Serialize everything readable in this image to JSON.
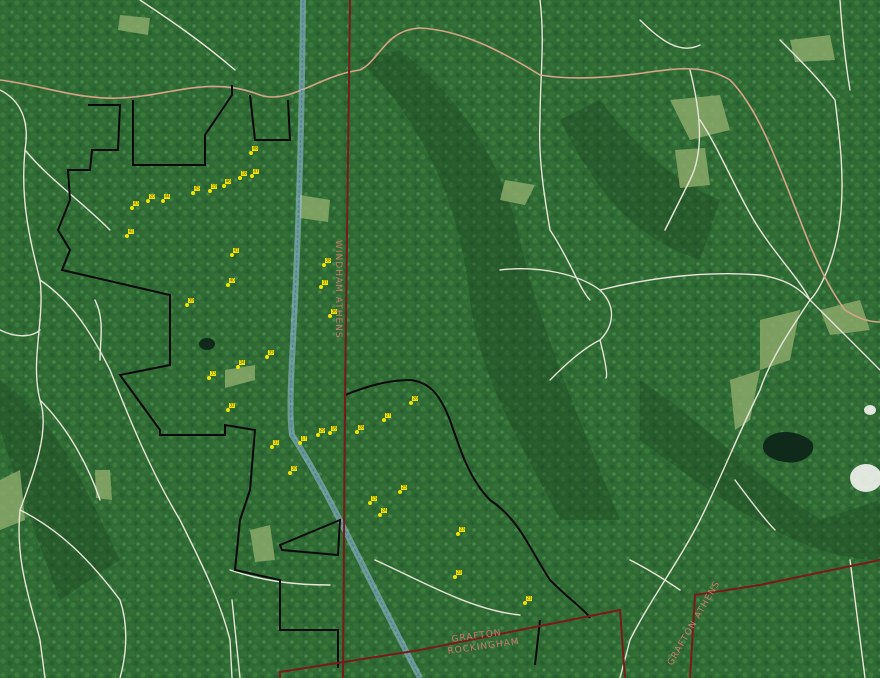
{
  "colors": {
    "forest_base": "#2f6a34",
    "forest_dark": "#1f4e27",
    "forest_light": "#4a8a47",
    "clearing": "#8aa96a",
    "road": "#e6e6d8",
    "highway": "#d7a48a",
    "boundary": "#0a0a0a",
    "town_line": "#7a1a1a",
    "powerline": "#7fb3d5",
    "marker": "#f2e600",
    "water": "#0f2a1a"
  },
  "labels": {
    "town_vertical": "WINDHAM ATHENS",
    "town_bottom_top": "GRAFTON",
    "town_bottom_bottom": "ROCKINGHAM",
    "town_bottom_right": "GRAFTON ATHENS"
  },
  "markers": [
    "48",
    "47",
    "46",
    "45",
    "44",
    "43",
    "42",
    "41",
    "40",
    "39",
    "38",
    "37",
    "36",
    "35",
    "34",
    "33",
    "32",
    "31",
    "30",
    "29",
    "28",
    "27",
    "26",
    "25",
    "24",
    "23",
    "22",
    "21",
    "20",
    "19",
    "18",
    "17",
    "16",
    "15"
  ]
}
